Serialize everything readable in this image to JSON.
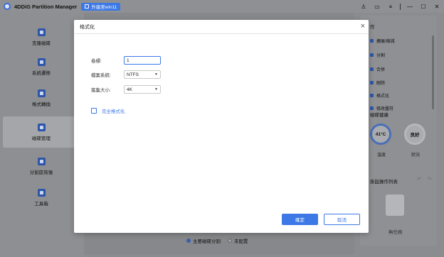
{
  "app": {
    "name": "4DDiG Partition Manager",
    "upgrade_label": "升級至win11"
  },
  "window_controls": {
    "user": "♙",
    "feedback": "▭",
    "menu": "≡",
    "minimize": "—",
    "maximize": "☐",
    "close": "✕"
  },
  "sidebar": {
    "items": [
      {
        "label": "克隆磁碟",
        "icon": "clone-disk-icon"
      },
      {
        "label": "系統遷移",
        "icon": "system-migration-icon"
      },
      {
        "label": "格式轉換",
        "icon": "format-convert-icon"
      },
      {
        "label": "磁碟管理",
        "icon": "disk-management-icon",
        "active": true
      },
      {
        "label": "分割區恢復",
        "icon": "partition-recovery-icon"
      },
      {
        "label": "工具箱",
        "icon": "toolbox-icon"
      }
    ]
  },
  "right_panel": {
    "title": "作",
    "operations": [
      "擴展/縮減",
      "分割",
      "合併",
      "刪除",
      "格式化",
      "修改盤符"
    ],
    "health_title": "磁碟健康",
    "temperature": {
      "value": "41°C",
      "label": "溫度"
    },
    "status": {
      "value": "良好",
      "label": "狀況"
    },
    "pending_title": "掛起操作列表",
    "pending_empty": "無任務"
  },
  "legend": {
    "primary": "主要磁碟分割",
    "unallocated": "未配置"
  },
  "modal": {
    "title": "格式化",
    "close": "×",
    "label_label": "卷標:",
    "label_value": "1",
    "fs_label": "檔案系統:",
    "fs_value": "NTFS",
    "cluster_label": "簇集大小:",
    "cluster_value": "4K",
    "quick_format_label": "完全格式化",
    "ok": "確定",
    "cancel": "取消"
  },
  "colors": {
    "accent": "#3c78e6",
    "sidebar_icon": "#2e55a8"
  }
}
